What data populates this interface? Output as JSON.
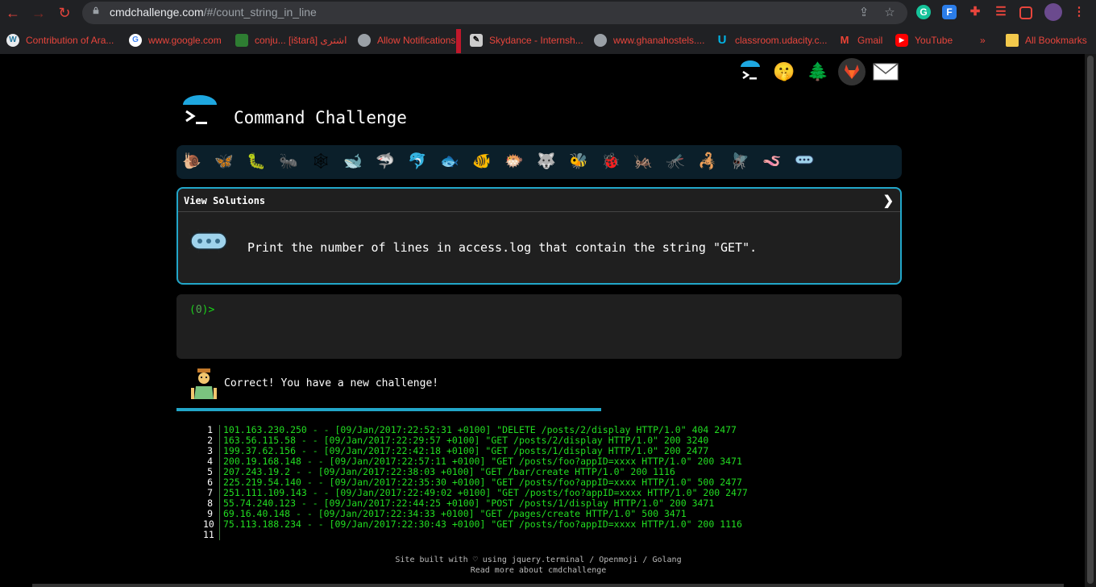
{
  "browser": {
    "url_host": "cmdchallenge.com",
    "url_path": "/#/count_string_in_line",
    "bookmarks": [
      {
        "label": "Contribution of Ara..."
      },
      {
        "label": "www.google.com"
      },
      {
        "label": "conju... [ištarā] اشترى"
      },
      {
        "label": "Allow Notifications"
      },
      {
        "label": "Skydance - Internsh..."
      },
      {
        "label": "www.ghanahostels...."
      },
      {
        "label": "classroom.udacity.c..."
      },
      {
        "label": "Gmail"
      },
      {
        "label": "YouTube"
      },
      {
        "label": "All Bookmarks"
      }
    ],
    "overflow_label": "»"
  },
  "page": {
    "title": "Command Challenge",
    "view_solutions_label": "View Solutions",
    "chevron": "❯",
    "task": "Print the number of lines in access.log that contain the string \"GET\".",
    "prompt_open": "(",
    "prompt_count": "0",
    "prompt_close": ")>",
    "feedback": "Correct! You have a new challenge!",
    "footer_line1": "Site built with ♡ using jquery.terminal / Openmoji / Golang",
    "footer_line2": "Read more about cmdchallenge"
  },
  "progress": {
    "fraction": 0.585,
    "color": "#22a6c9"
  },
  "animals": [
    "snail-icon",
    "butterfly-icon",
    "caterpillar-icon",
    "ant-icon",
    "spider-web-icon",
    "whale-icon",
    "shark-icon",
    "dolphin-icon",
    "fish-icon",
    "tropical-fish-icon",
    "blowfish-icon",
    "wolf-icon",
    "bee-icon",
    "ladybug-icon",
    "cricket-icon",
    "mosquito-icon",
    "scorpion-icon",
    "fly-icon",
    "worm-icon",
    "microbe-icon"
  ],
  "log_lines": [
    {
      "n": "1",
      "text": "101.163.230.250 - - [09/Jan/2017:22:52:31 +0100] \"DELETE /posts/2/display HTTP/1.0\" 404 2477"
    },
    {
      "n": "2",
      "text": "163.56.115.58 - - [09/Jan/2017:22:29:57 +0100] \"GET /posts/2/display HTTP/1.0\" 200 3240"
    },
    {
      "n": "3",
      "text": "199.37.62.156 - - [09/Jan/2017:22:42:18 +0100] \"GET /posts/1/display HTTP/1.0\" 200 2477"
    },
    {
      "n": "4",
      "text": "200.19.168.148 - - [09/Jan/2017:22:57:11 +0100] \"GET /posts/foo?appID=xxxx HTTP/1.0\" 200 3471"
    },
    {
      "n": "5",
      "text": "207.243.19.2 - - [09/Jan/2017:22:38:03 +0100] \"GET /bar/create HTTP/1.0\" 200 1116"
    },
    {
      "n": "6",
      "text": "225.219.54.140 - - [09/Jan/2017:22:35:30 +0100] \"GET /posts/foo?appID=xxxx HTTP/1.0\" 500 2477"
    },
    {
      "n": "7",
      "text": "251.111.109.143 - - [09/Jan/2017:22:49:02 +0100] \"GET /posts/foo?appID=xxxx HTTP/1.0\" 200 2477"
    },
    {
      "n": "8",
      "text": "55.74.240.123 - - [09/Jan/2017:22:44:25 +0100] \"POST /posts/1/display HTTP/1.0\" 200 3471"
    },
    {
      "n": "9",
      "text": "69.16.40.148 - - [09/Jan/2017:22:34:33 +0100] \"GET /pages/create HTTP/1.0\" 500 3471"
    },
    {
      "n": "10",
      "text": "75.113.188.234 - - [09/Jan/2017:22:30:43 +0100] \"GET /posts/foo?appID=xxxx HTTP/1.0\" 200 1116"
    },
    {
      "n": "11",
      "text": ""
    }
  ]
}
